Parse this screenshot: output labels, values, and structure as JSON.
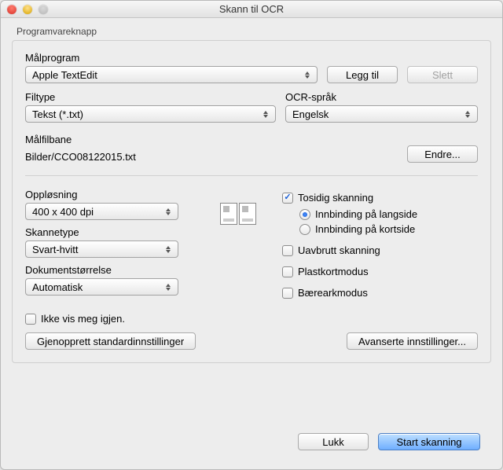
{
  "window": {
    "title": "Skann til OCR"
  },
  "group": {
    "title": "Programvareknapp"
  },
  "top": {
    "targetApp": {
      "label": "Målprogram",
      "value": "Apple TextEdit"
    },
    "addButton": "Legg til",
    "deleteButton": "Slett",
    "fileType": {
      "label": "Filtype",
      "value": "Tekst (*.txt)"
    },
    "ocrLang": {
      "label": "OCR-språk",
      "value": "Engelsk"
    },
    "filePath": {
      "label": "Målfilbane",
      "value": "Bilder/CCO08122015.txt"
    },
    "changeButton": "Endre..."
  },
  "bottom": {
    "resolution": {
      "label": "Oppløsning",
      "value": "400 x 400 dpi"
    },
    "scanType": {
      "label": "Skannetype",
      "value": "Svart-hvitt"
    },
    "docSize": {
      "label": "Dokumentstørrelse",
      "value": "Automatisk"
    },
    "duplex": {
      "label": "Tosidig skanning",
      "longSide": "Innbinding på langside",
      "shortSide": "Innbinding på kortside"
    },
    "continuous": "Uavbrutt skanning",
    "plasticCard": "Plastkortmodus",
    "carrierSheet": "Bærearkmodus",
    "dontShow": "Ikke vis meg igjen.",
    "restoreDefaults": "Gjenopprett standardinnstillinger",
    "advanced": "Avanserte innstillinger..."
  },
  "footer": {
    "close": "Lukk",
    "start": "Start skanning"
  }
}
